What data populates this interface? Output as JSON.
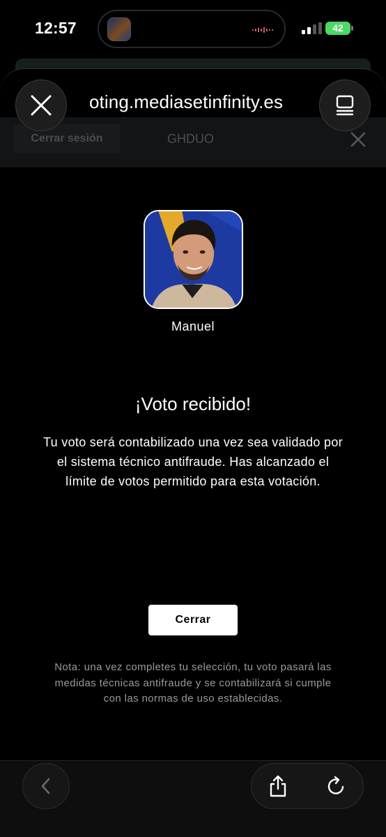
{
  "status_bar": {
    "time": "12:57",
    "battery": "42",
    "battery_color": "#4cd964"
  },
  "browser": {
    "url": "oting.mediasetinfinity.es",
    "close_icon": "close-icon",
    "tabs_icon": "tabs-icon"
  },
  "site_header": {
    "logout_label": "Cerrar sesión",
    "user_code": "GHDUO"
  },
  "candidate": {
    "name": "Manuel"
  },
  "confirmation": {
    "title": "¡Voto recibido!",
    "message": "Tu voto será contabilizado una vez sea validado por el sistema técnico antifraude. Has alcanzado el límite de votos permitido para esta votación."
  },
  "close_button_label": "Cerrar",
  "note": "Nota: una vez completes tu selección, tu voto pasará las medidas técnicas antifraude y se contabilizará si cumple con las normas de uso establecidas.",
  "toolbar": {
    "back_icon": "chevron-left-icon",
    "share_icon": "share-icon",
    "reload_icon": "reload-icon"
  }
}
